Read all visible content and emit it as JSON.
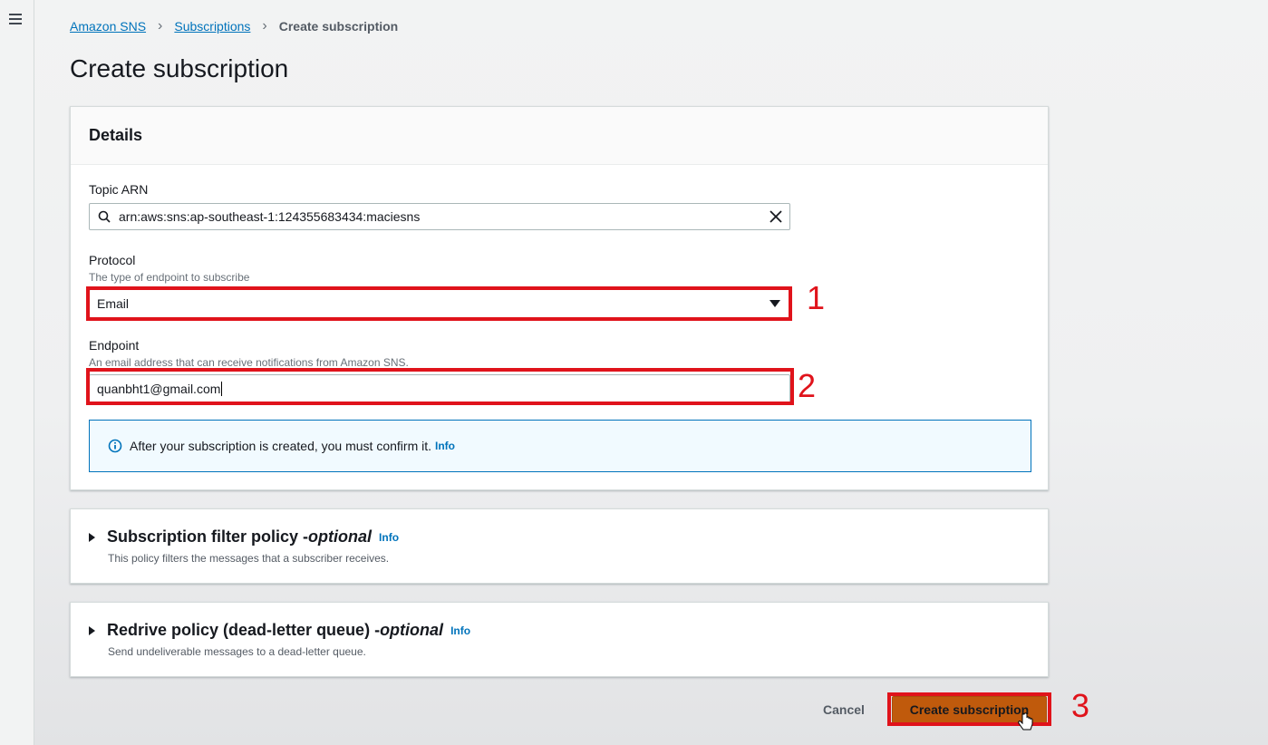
{
  "breadcrumb": {
    "items": [
      "Amazon SNS",
      "Subscriptions",
      "Create subscription"
    ]
  },
  "page": {
    "title": "Create subscription"
  },
  "details": {
    "header": "Details",
    "topic_arn_label": "Topic ARN",
    "topic_arn_value": "arn:aws:sns:ap-southeast-1:124355683434:maciesns",
    "protocol_label": "Protocol",
    "protocol_desc": "The type of endpoint to subscribe",
    "protocol_value": "Email",
    "endpoint_label": "Endpoint",
    "endpoint_desc": "An email address that can receive notifications from Amazon SNS.",
    "endpoint_value": "quanbht1@gmail.com",
    "alert_text": "After your subscription is created, you must confirm it.",
    "alert_link": "Info"
  },
  "filter_policy": {
    "title": "Subscription filter policy - ",
    "title_optional": "optional",
    "info": "Info",
    "desc": "This policy filters the messages that a subscriber receives."
  },
  "redrive_policy": {
    "title": "Redrive policy (dead-letter queue) - ",
    "title_optional": "optional",
    "info": "Info",
    "desc": "Send undeliverable messages to a dead-letter queue."
  },
  "actions": {
    "cancel": "Cancel",
    "create": "Create subscription"
  },
  "annotations": [
    "1",
    "2",
    "3"
  ],
  "colors": {
    "link": "#0073bb",
    "primary_button": "#c05a0c",
    "annotation": "#e0131b",
    "info_border": "#0073bb"
  }
}
